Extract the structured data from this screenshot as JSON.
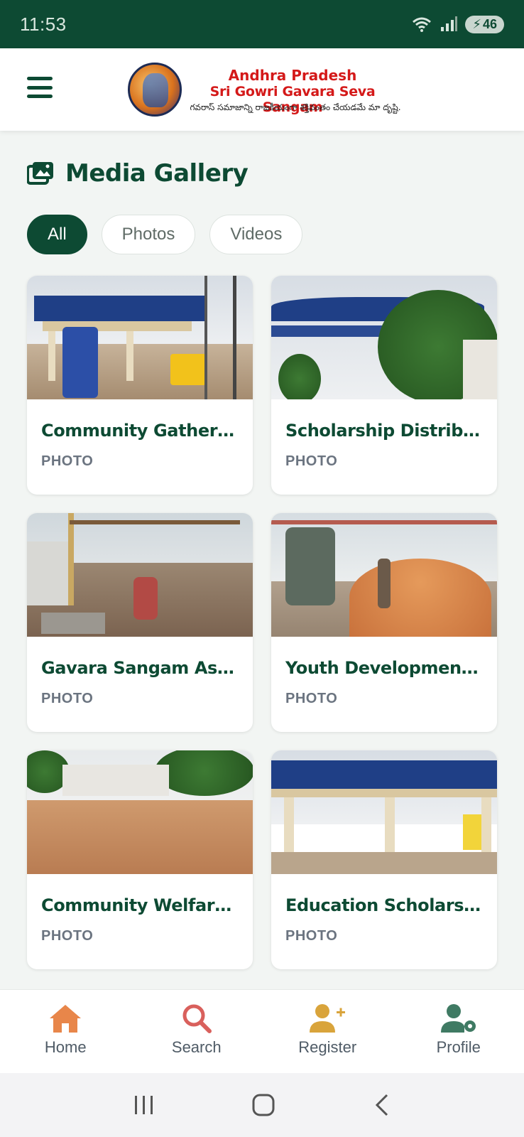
{
  "status_bar": {
    "time": "11:53",
    "battery": "46"
  },
  "header": {
    "title_line1": "Andhra Pradesh",
    "title_line2": "Sri Gowri Gavara Seva Sangam",
    "tagline": "గవరాస్ సమాజాన్ని రాజకీయంగా శక్తివంతం చేయడమే మా దృష్టి.",
    "menu_icon": "hamburger-menu-icon"
  },
  "page": {
    "title": "Media Gallery",
    "title_icon": "photo-gallery-icon"
  },
  "tabs": [
    {
      "label": "All",
      "active": true
    },
    {
      "label": "Photos",
      "active": false
    },
    {
      "label": "Videos",
      "active": false
    }
  ],
  "gallery": [
    {
      "title": "Community Gathering...",
      "type": "PHOTO"
    },
    {
      "title": "Scholarship Distributi...",
      "type": "PHOTO"
    },
    {
      "title": "Gavara Sangam Asse...",
      "type": "PHOTO"
    },
    {
      "title": "Youth Development W...",
      "type": "PHOTO"
    },
    {
      "title": "Community Welfare T...",
      "type": "PHOTO"
    },
    {
      "title": "Education Scholarship...",
      "type": "PHOTO"
    }
  ],
  "bottom_nav": [
    {
      "label": "Home",
      "icon": "home-icon",
      "color": "#e8864a"
    },
    {
      "label": "Search",
      "icon": "search-icon",
      "color": "#d9605c"
    },
    {
      "label": "Register",
      "icon": "add-user-icon",
      "color": "#d9a43b"
    },
    {
      "label": "Profile",
      "icon": "user-settings-icon",
      "color": "#3f7a63"
    }
  ],
  "colors": {
    "primary": "#0d4a33",
    "background": "#f2f5f3",
    "accent_red": "#d41919"
  }
}
